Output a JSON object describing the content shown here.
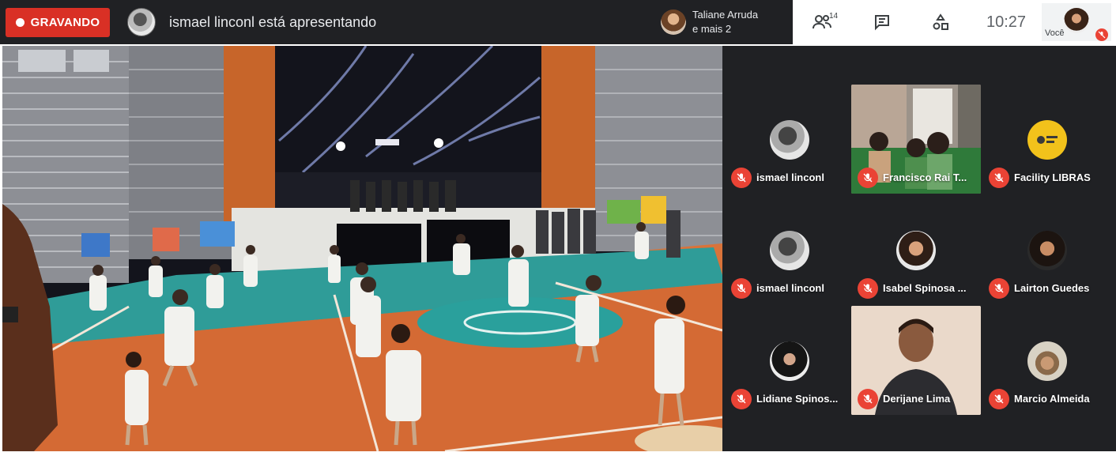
{
  "recording": {
    "label": "GRAVANDO"
  },
  "presenter": {
    "text": "ismael linconl está apresentando"
  },
  "extra_participants": {
    "line1": "Taliane Arruda",
    "line2": "e mais 2"
  },
  "toolbar": {
    "participants_icon": "people-icon",
    "participants_count": "14",
    "chat_icon": "chat-icon",
    "activities_icon": "activities-icon",
    "time": "10:27"
  },
  "self_view": {
    "label": "Você",
    "mic_icon": "mic-off-icon"
  },
  "participants": [
    {
      "name": "ismael linconl",
      "kind": "avatar"
    },
    {
      "name": "Francisco Rai T...",
      "kind": "video"
    },
    {
      "name": "Facility LIBRAS",
      "kind": "avatar"
    },
    {
      "name": "ismael linconl",
      "kind": "avatar"
    },
    {
      "name": "Isabel Spinosa ...",
      "kind": "avatar"
    },
    {
      "name": "Lairton Guedes",
      "kind": "avatar"
    },
    {
      "name": "Lidiane Spinos...",
      "kind": "avatar"
    },
    {
      "name": "Derijane Lima",
      "kind": "video"
    },
    {
      "name": "Marcio Almeida",
      "kind": "avatar"
    }
  ],
  "colors": {
    "recording_red": "#d93025",
    "mic_off_red": "#ea4335",
    "dark_bg": "#202124"
  }
}
